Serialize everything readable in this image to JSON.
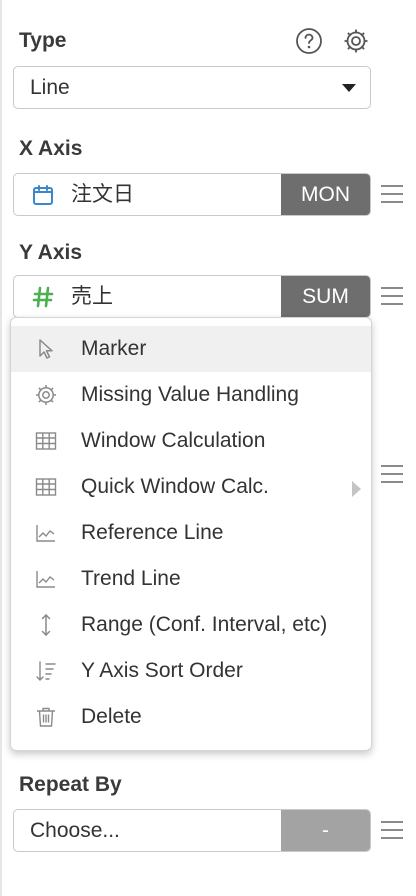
{
  "type_section": {
    "title": "Type",
    "selected": "Line",
    "help_icon": "question-circle-icon",
    "settings_icon": "gear-icon"
  },
  "x_axis": {
    "title": "X Axis",
    "field_label": "注文日",
    "field_icon": "calendar-icon",
    "aggregation": "MON"
  },
  "y_axis": {
    "title": "Y Axis",
    "field_label": "売上",
    "field_icon": "hash-icon",
    "aggregation": "SUM"
  },
  "context_menu": {
    "items": [
      {
        "label": "Marker",
        "icon": "cursor-icon",
        "highlighted": true
      },
      {
        "label": "Missing Value Handling",
        "icon": "gear-icon"
      },
      {
        "label": "Window Calculation",
        "icon": "table-icon"
      },
      {
        "label": "Quick Window Calc.",
        "icon": "table-icon",
        "has_submenu": true
      },
      {
        "label": "Reference Line",
        "icon": "line-chart-icon"
      },
      {
        "label": "Trend Line",
        "icon": "line-chart-icon"
      },
      {
        "label": "Range (Conf. Interval, etc)",
        "icon": "vertical-arrows-icon"
      },
      {
        "label": "Y Axis Sort Order",
        "icon": "sort-icon"
      },
      {
        "label": "Delete",
        "icon": "trash-icon"
      }
    ]
  },
  "repeat_by": {
    "title": "Repeat By",
    "placeholder": "Choose...",
    "aggregation": "-"
  },
  "colors": {
    "aggregation_bg": "#6e6e6e",
    "aggregation_bg_empty": "#a3a3a3",
    "calendar_blue": "#3a87c9",
    "hash_green": "#4caf50",
    "menu_hover": "#f0f0f0"
  }
}
